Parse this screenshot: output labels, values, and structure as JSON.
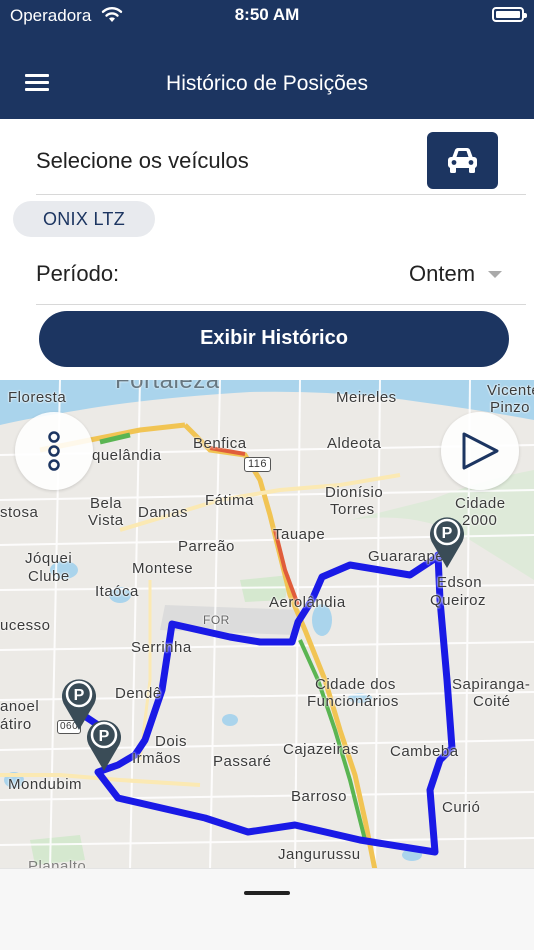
{
  "status_bar": {
    "carrier": "Operadora",
    "time": "8:50 AM"
  },
  "header": {
    "title": "Histórico de Posições",
    "menu_icon": "hamburger-icon"
  },
  "vehicle_select": {
    "label": "Selecione os veículos",
    "button_icon": "car-icon"
  },
  "selected_vehicles": [
    {
      "name": "ONIX LTZ"
    }
  ],
  "period": {
    "label": "Período:",
    "value": "Ontem"
  },
  "show_history_button": "Exibir Histórico",
  "map": {
    "controls": {
      "layers_icon": "three-dots-icon",
      "play_icon": "play-icon"
    },
    "labels": [
      {
        "text": "Fortaleza"
      },
      {
        "text": "Floresta"
      },
      {
        "text": "Meireles"
      },
      {
        "text": "Vicente"
      },
      {
        "text": "Pinzo"
      },
      {
        "text": "Benfica"
      },
      {
        "text": "Aldeota"
      },
      {
        "text": "quelândia"
      },
      {
        "text": "Fátima"
      },
      {
        "text": "Dionísio"
      },
      {
        "text": "Torres"
      },
      {
        "text": "Cidade"
      },
      {
        "text": "2000"
      },
      {
        "text": "Bela"
      },
      {
        "text": "Vista"
      },
      {
        "text": "Damas"
      },
      {
        "text": "stosa"
      },
      {
        "text": "Tauape"
      },
      {
        "text": "Parreão"
      },
      {
        "text": "Jóquei"
      },
      {
        "text": "Clube"
      },
      {
        "text": "Montese"
      },
      {
        "text": "Guararapes"
      },
      {
        "text": "Edson"
      },
      {
        "text": "Queiroz"
      },
      {
        "text": "Itaóca"
      },
      {
        "text": "Aerolândia"
      },
      {
        "text": "FOR"
      },
      {
        "text": "ucesso"
      },
      {
        "text": "Serrinha"
      },
      {
        "text": "Dendê"
      },
      {
        "text": "Cidade dos"
      },
      {
        "text": "Funcionários"
      },
      {
        "text": "Sapiranga-"
      },
      {
        "text": "Coité"
      },
      {
        "text": "anoel"
      },
      {
        "text": "átiro"
      },
      {
        "text": "Dois"
      },
      {
        "text": "Irmãos"
      },
      {
        "text": "Passaré"
      },
      {
        "text": "Cajazeiras"
      },
      {
        "text": "Cambeba"
      },
      {
        "text": "Mondubim"
      },
      {
        "text": "Barroso"
      },
      {
        "text": "Curió"
      },
      {
        "text": "Jangurussu"
      },
      {
        "text": "Planalto"
      }
    ],
    "road_shields": [
      {
        "text": "116"
      },
      {
        "text": "060"
      }
    ],
    "route_color": "#1a1ae6",
    "pin_color": "#3a4c57",
    "pin_icon": "parking-icon"
  }
}
